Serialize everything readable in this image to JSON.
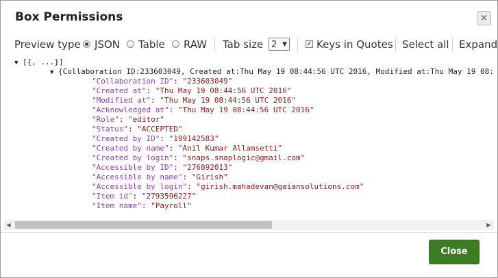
{
  "dialog": {
    "title": "Box Permissions",
    "close_icon": "×",
    "close_button": "Close"
  },
  "toolbar": {
    "preview_type_label": "Preview type",
    "options": [
      {
        "label": "JSON",
        "selected": true
      },
      {
        "label": "Table",
        "selected": false
      },
      {
        "label": "RAW",
        "selected": false
      }
    ],
    "tab_size_label": "Tab size",
    "tab_size_value": "2",
    "keys_in_quotes_label": "Keys in Quotes",
    "keys_in_quotes_checked": true,
    "select_all_label": "Select all",
    "expand_label": "Expand"
  },
  "tree": {
    "root_label": "[{, ...}]",
    "item_summary": "{Collaboration ID:233603049, Created at:Thu May 19 08:44:56 UTC 2016, Modified at:Thu May 19 08:",
    "fields": [
      {
        "key": "\"Collaboration ID\"",
        "value": "\"233603049\""
      },
      {
        "key": "\"Created at\"",
        "value": "\"Thu May 19 08:44:56 UTC 2016\""
      },
      {
        "key": "\"Modified at\"",
        "value": "\"Thu May 19 08:44:56 UTC 2016\""
      },
      {
        "key": "\"Acknowledged at\"",
        "value": "\"Thu May 19 08:44:56 UTC 2016\""
      },
      {
        "key": "\"Role\"",
        "value": "\"editor\""
      },
      {
        "key": "\"Status\"",
        "value": "\"ACCEPTED\""
      },
      {
        "key": "\"Created by ID\"",
        "value": "\"199142583\""
      },
      {
        "key": "\"Created by name\"",
        "value": "\"Anil Kumar Allamsetti\""
      },
      {
        "key": "\"Created by login\"",
        "value": "\"snaps.snaplogic@gmail.com\""
      },
      {
        "key": "\"Accessible by ID\"",
        "value": "\"276892013\""
      },
      {
        "key": "\"Accessible by name\"",
        "value": "\"Girish\""
      },
      {
        "key": "\"Accessible by login\"",
        "value": "\"girish.mahadevan@gaiansolutions.com\""
      },
      {
        "key": "\"Item id\"",
        "value": "\"2793596227\""
      },
      {
        "key": "\"Item name\"",
        "value": "\"Payroll\""
      }
    ]
  },
  "colors": {
    "key": "#8f3fb0",
    "value": "#8b1a1a",
    "close_button": "#3b7d23"
  }
}
